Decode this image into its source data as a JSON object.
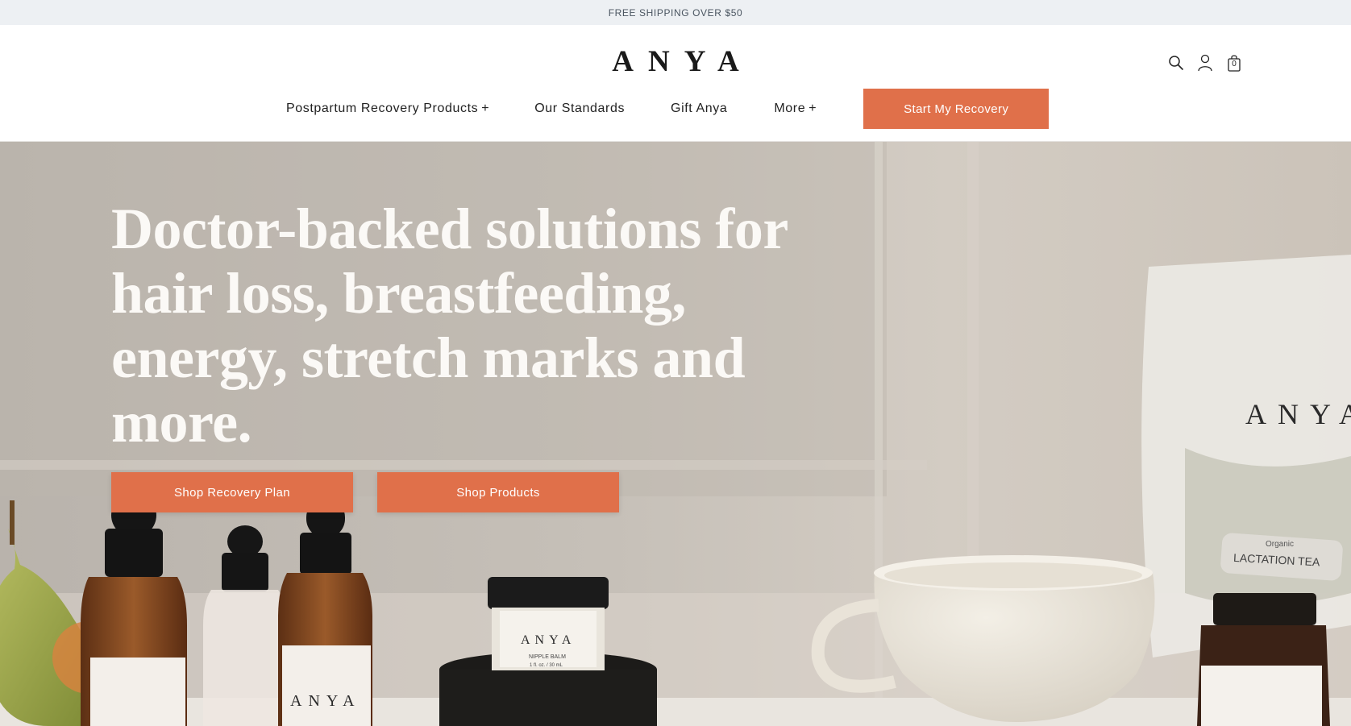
{
  "announcement": {
    "text": "FREE SHIPPING OVER $50"
  },
  "header": {
    "logo": "ANYA",
    "cart_count": "0",
    "nav": {
      "items": [
        {
          "label": "Postpartum Recovery Products",
          "has_plus": true
        },
        {
          "label": "Our Standards",
          "has_plus": false
        },
        {
          "label": "Gift Anya",
          "has_plus": false
        },
        {
          "label": "More",
          "has_plus": true
        }
      ],
      "plus_glyph": "+",
      "cta_label": "Start My Recovery"
    },
    "icons": [
      "search-icon",
      "account-icon",
      "cart-icon"
    ]
  },
  "hero": {
    "headline": "Doctor-backed solutions for hair loss, breastfeeding, energy, stretch marks and more.",
    "buttons": [
      "Shop Recovery Plan",
      "Shop Products"
    ],
    "product_labels": {
      "dropper": "ANYA",
      "jar_brand": "ANYA",
      "jar_name": "NIPPLE BALM",
      "jar_size": "1 fl. oz. / 30 mL",
      "tea_brand": "ANYA",
      "tea_name": "LACTATION TEA",
      "tea_sub": "Organic"
    }
  },
  "colors": {
    "accent": "#e0704a",
    "announcement_bg": "#edf0f3",
    "headline": "#fbf9f6"
  }
}
